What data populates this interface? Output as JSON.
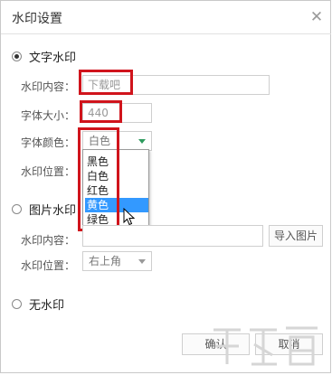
{
  "dialog": {
    "title": "水印设置"
  },
  "text_watermark": {
    "radio_label": "文字水印",
    "content_label": "水印内容：",
    "content_value": "下载吧",
    "font_size_label": "字体大小：",
    "font_size_value": "440",
    "font_color_label": "字体颜色：",
    "font_color_value": "白色",
    "color_options": [
      "黑色",
      "白色",
      "红色",
      "黄色",
      "绿色"
    ],
    "highlighted_option": "黄色",
    "position_label": "水印位置："
  },
  "image_watermark": {
    "radio_label": "图片水印",
    "content_label": "水印内容：",
    "import_button": "导入图片",
    "position_label": "水印位置：",
    "position_value": "右上角"
  },
  "no_watermark": {
    "radio_label": "无水印"
  },
  "footer": {
    "confirm_label": "确认",
    "cancel_label": "取消"
  },
  "colors": {
    "highlight": "#3399ff",
    "annotation_red": "#d0141c",
    "dropdown_arrow": "#2e9b5e"
  },
  "icons": {
    "close": "close-icon",
    "cursor": "mouse-cursor-icon"
  }
}
